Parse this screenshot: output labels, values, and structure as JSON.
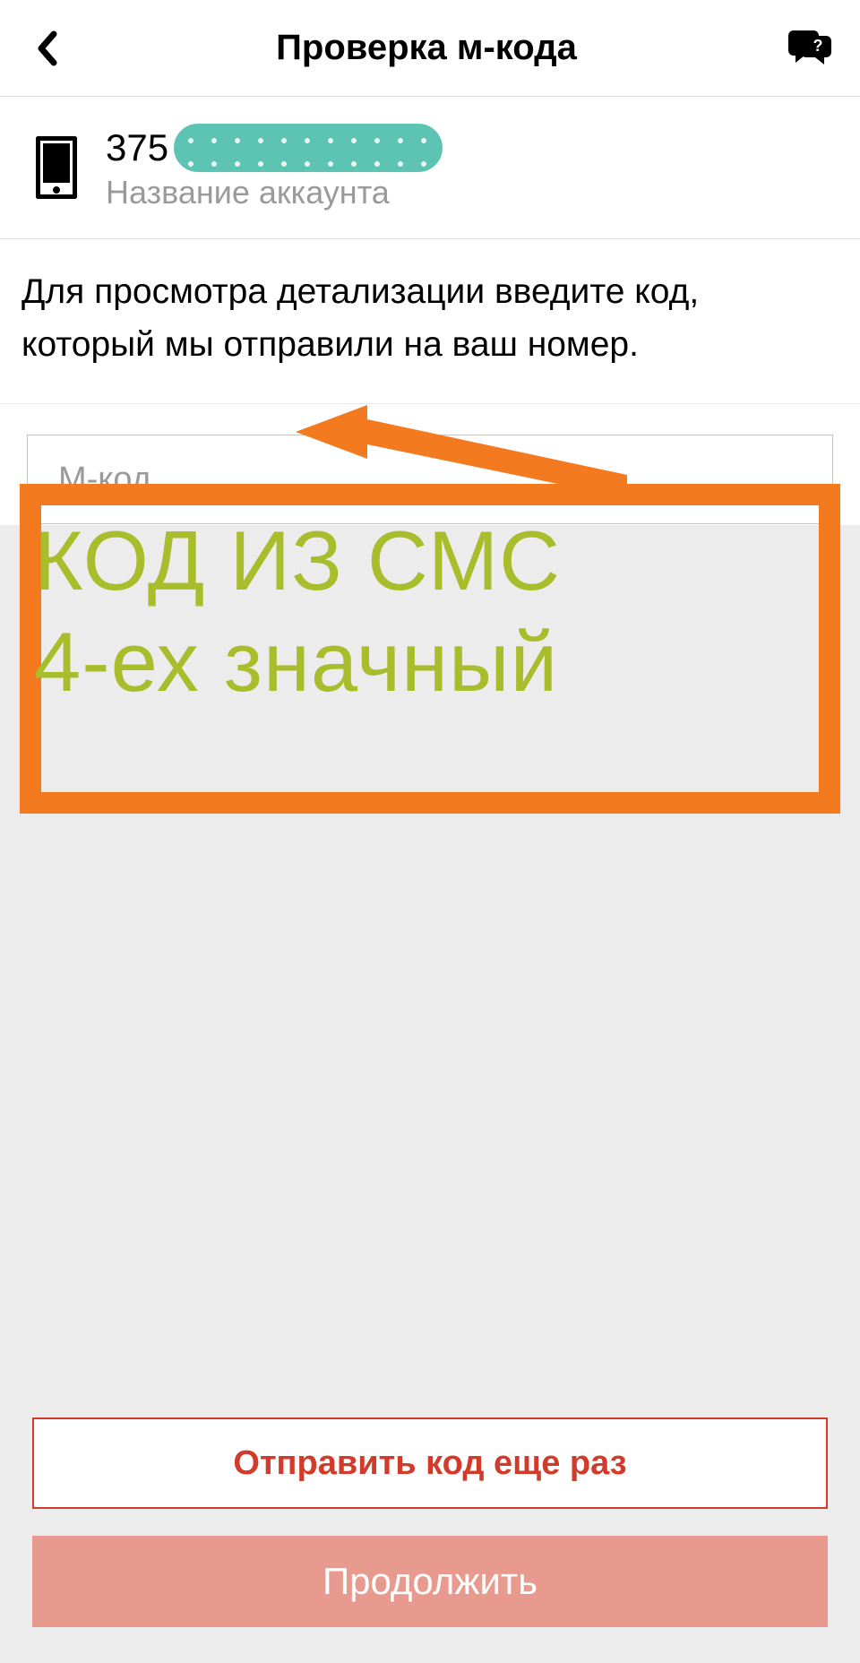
{
  "header": {
    "title": "Проверка м-кода"
  },
  "account": {
    "phone_prefix": "375",
    "name_label": "Название аккаунта"
  },
  "instruction_text": "Для просмотра детализации введите код, который мы отправили на ваш номер.",
  "input": {
    "placeholder": "М-код",
    "value": ""
  },
  "annotation": {
    "text": "КОД ИЗ СМС\n4-ех значный"
  },
  "buttons": {
    "resend": "Отправить код еще раз",
    "continue": "Продолжить"
  },
  "colors": {
    "brand_red": "#d23a2a",
    "continue_bg": "#e89a8f",
    "annotation_border": "#f47a1f",
    "annotation_text": "#a7bd2b",
    "mask_bg": "#5dc3b3"
  }
}
